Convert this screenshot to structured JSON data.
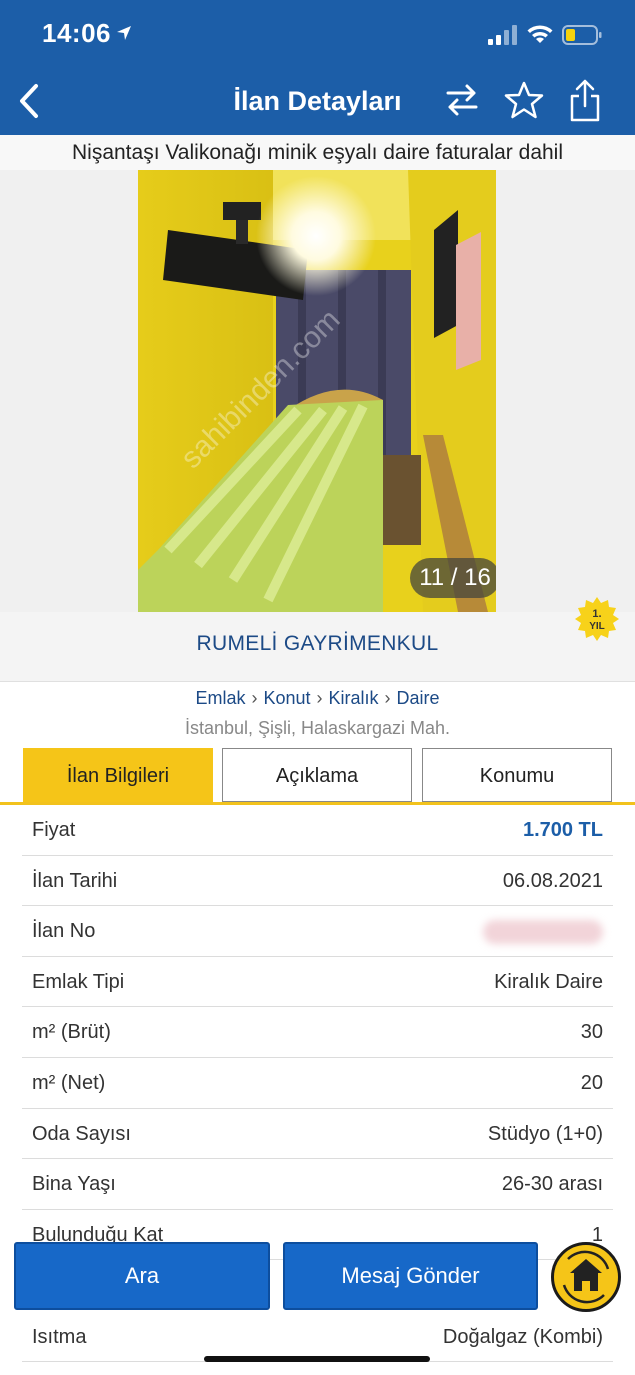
{
  "status_bar": {
    "time": "14:06"
  },
  "nav": {
    "title": "İlan Detayları"
  },
  "listing": {
    "title": "Nişantaşı Valikonağı minik eşyalı daire faturalar dahil",
    "photo_counter": "11 / 16",
    "watermark": "sahibinden.com"
  },
  "agency": {
    "name": "RUMELİ GAYRİMENKUL",
    "badge_line1": "1.",
    "badge_line2": "YIL"
  },
  "breadcrumb": [
    "Emlak",
    "Konut",
    "Kiralık",
    "Daire"
  ],
  "breadcrumb_sep": "›",
  "location": "İstanbul, Şişli, Halaskargazi Mah.",
  "tabs": [
    {
      "label": "İlan Bilgileri",
      "active": true
    },
    {
      "label": "Açıklama",
      "active": false
    },
    {
      "label": "Konumu",
      "active": false
    }
  ],
  "details": [
    {
      "label": "Fiyat",
      "value": "1.700 TL"
    },
    {
      "label": "İlan Tarihi",
      "value": "06.08.2021"
    },
    {
      "label": "İlan No",
      "value": ""
    },
    {
      "label": "Emlak Tipi",
      "value": "Kiralık Daire"
    },
    {
      "label": "m² (Brüt)",
      "value": "30"
    },
    {
      "label": "m² (Net)",
      "value": "20"
    },
    {
      "label": "Oda Sayısı",
      "value": "Stüdyo (1+0)"
    },
    {
      "label": "Bina Yaşı",
      "value": "26-30 arası"
    },
    {
      "label": "Bulunduğu Kat",
      "value": "1"
    }
  ],
  "last_detail": {
    "label": "Isıtma",
    "value": "Doğalgaz (Kombi)"
  },
  "actions": {
    "call": "Ara",
    "message": "Mesaj Gönder"
  },
  "colors": {
    "header": "#1c5ea8",
    "accent": "#f5c518",
    "button": "#1768c8"
  }
}
